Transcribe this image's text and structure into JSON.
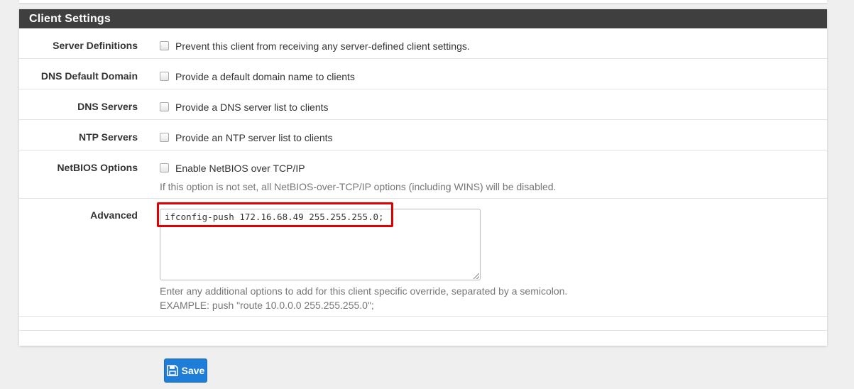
{
  "panel": {
    "title": "Client Settings"
  },
  "rows": [
    {
      "label": "Server Definitions",
      "checkbox_text": "Prevent this client from receiving any server-defined client settings."
    },
    {
      "label": "DNS Default Domain",
      "checkbox_text": "Provide a default domain name to clients"
    },
    {
      "label": "DNS Servers",
      "checkbox_text": "Provide a DNS server list to clients"
    },
    {
      "label": "NTP Servers",
      "checkbox_text": "Provide an NTP server list to clients"
    },
    {
      "label": "NetBIOS Options",
      "checkbox_text": "Enable NetBIOS over TCP/IP",
      "help": "If this option is not set, all NetBIOS-over-TCP/IP options (including WINS) will be disabled."
    }
  ],
  "advanced": {
    "label": "Advanced",
    "value": "ifconfig-push 172.16.68.49 255.255.255.0;",
    "help_line1": "Enter any additional options to add for this client specific override, separated by a semicolon.",
    "help_line2": "EXAMPLE: push \"route 10.0.0.0 255.255.255.0\";"
  },
  "actions": {
    "save_label": "Save",
    "save_icon": "save-icon"
  },
  "colors": {
    "panel_heading": "#3f3f3f",
    "save_button": "#1e7dd7",
    "highlight_box": "#e00000"
  }
}
